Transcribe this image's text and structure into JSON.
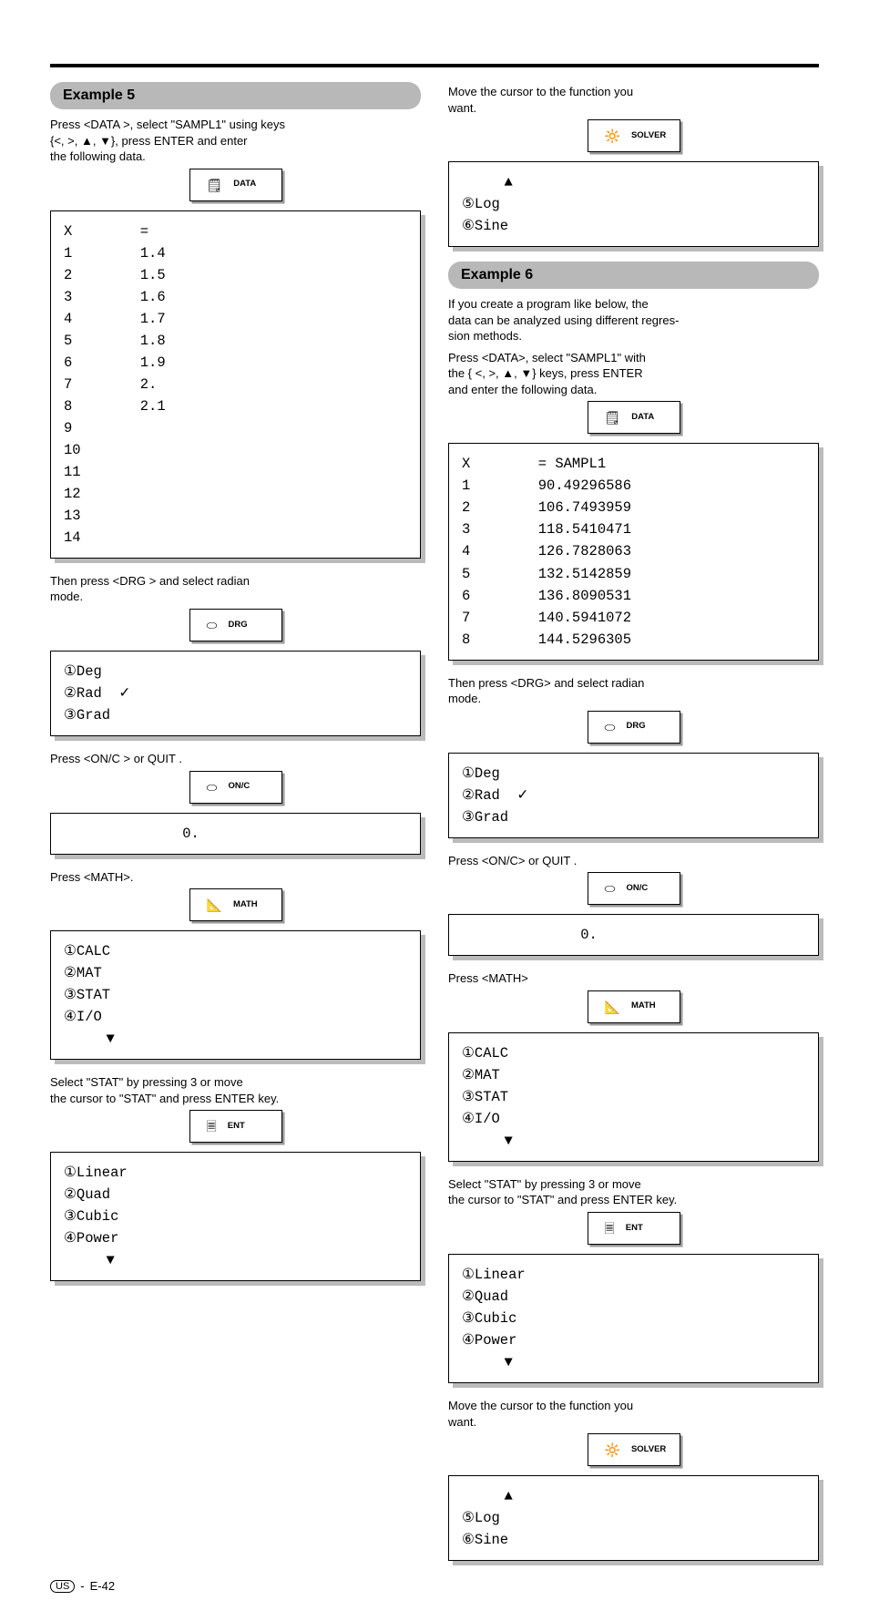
{
  "icons": {
    "data": "🗒",
    "drg": "⬭",
    "on_c": "⬭",
    "math": "📐",
    "ent": "🗏",
    "solver": "🔆"
  },
  "left": {
    "section": "Example 5",
    "step1": {
      "label": "DATA",
      "text": "Press <DATA >, select \"SAMPL1\" using keys\n{<, >, ▲, ▼}, press ENTER  and enter\nthe following data.",
      "display": "X        =\n1        1.4\n2        1.5\n3        1.6\n4        1.7\n5        1.8\n6        1.9\n7        2.\n8        2.1\n9        \n10       \n11       \n12       \n13       \n14       "
    },
    "step2": {
      "label": "DRG",
      "text": "Then press <DRG > and select radian\nmode.",
      "display": "①Deg\n②Rad  ✓\n③Grad"
    },
    "step3": {
      "label": "ON/C",
      "text": "Press <ON/C > or  QUIT  .",
      "display": "              0."
    },
    "step4": {
      "label": "MATH",
      "text": "Press  <MATH>.",
      "display": "①CALC\n②MAT\n③STAT\n④I/O\n     ▼"
    },
    "step5": {
      "text": "Select \"STAT\" by pressing  3  or move\nthe cursor to \"STAT\" and press  ENTER  key.",
      "label": "ENT",
      "display": "①Linear\n②Quad\n③Cubic\n④Power\n     ▼"
    }
  },
  "right": {
    "step6": {
      "label": "SOLVER",
      "text": "Move the cursor to the function you\nwant.",
      "display": "     ▲\n⑤Log\n⑥Sine"
    },
    "section": "Example 6",
    "intro": "If you create a program like below, the\ndata can be analyzed using different regres-\nsion methods.",
    "step1": {
      "label": "DATA",
      "text": "Press <DATA>, select \"SAMPL1\" with\nthe { <, >,  ▲,  ▼} keys, press ENTER\nand enter the following data.",
      "display": "X        = SAMPL1\n1        90.49296586\n2        106.7493959\n3        118.5410471\n4        126.7828063\n5        132.5142859\n6        136.8090531\n7        140.5941072\n8        144.5296305"
    },
    "step2": {
      "label": "DRG",
      "text": "Then press <DRG> and select radian\nmode.",
      "display": "①Deg\n②Rad  ✓\n③Grad"
    },
    "step3": {
      "label": "ON/C",
      "text": "Press <ON/C> or  QUIT  .",
      "display": "              0."
    },
    "step4": {
      "label": "MATH",
      "text": "Press <MATH>",
      "display": "①CALC\n②MAT\n③STAT\n④I/O\n     ▼"
    },
    "step5": {
      "label": "ENT",
      "text": "Select \"STAT\" by pressing  3   or move\nthe cursor to \"STAT\" and press  ENTER  key.",
      "display": "①Linear\n②Quad\n③Cubic\n④Power\n     ▼"
    }
  },
  "footer": {
    "region": "US",
    "page": "E-42"
  }
}
